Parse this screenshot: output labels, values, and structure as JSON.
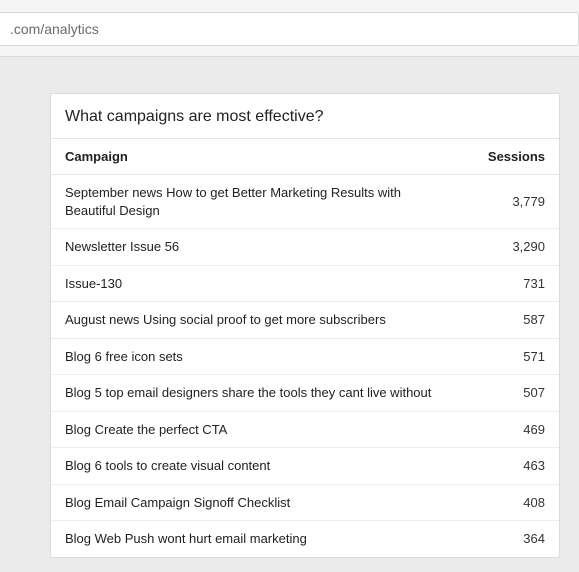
{
  "url_bar": ".com/analytics",
  "card": {
    "title": "What campaigns are most effective?",
    "columns": {
      "name": "Campaign",
      "sessions": "Sessions"
    },
    "rows": [
      {
        "name": "September news How to get Better Marketing Results with Beautiful Design",
        "sessions": "3,779"
      },
      {
        "name": "Newsletter Issue 56",
        "sessions": "3,290"
      },
      {
        "name": "Issue-130",
        "sessions": "731"
      },
      {
        "name": "August news Using social proof to get more subscribers",
        "sessions": "587"
      },
      {
        "name": "Blog 6 free icon sets",
        "sessions": "571"
      },
      {
        "name": "Blog 5 top email designers share the tools they cant live without",
        "sessions": "507"
      },
      {
        "name": "Blog Create the perfect CTA",
        "sessions": "469"
      },
      {
        "name": "Blog 6 tools to create visual content",
        "sessions": "463"
      },
      {
        "name": "Blog Email Campaign Signoff Checklist",
        "sessions": "408"
      },
      {
        "name": "Blog Web Push wont hurt email marketing",
        "sessions": "364"
      }
    ]
  }
}
